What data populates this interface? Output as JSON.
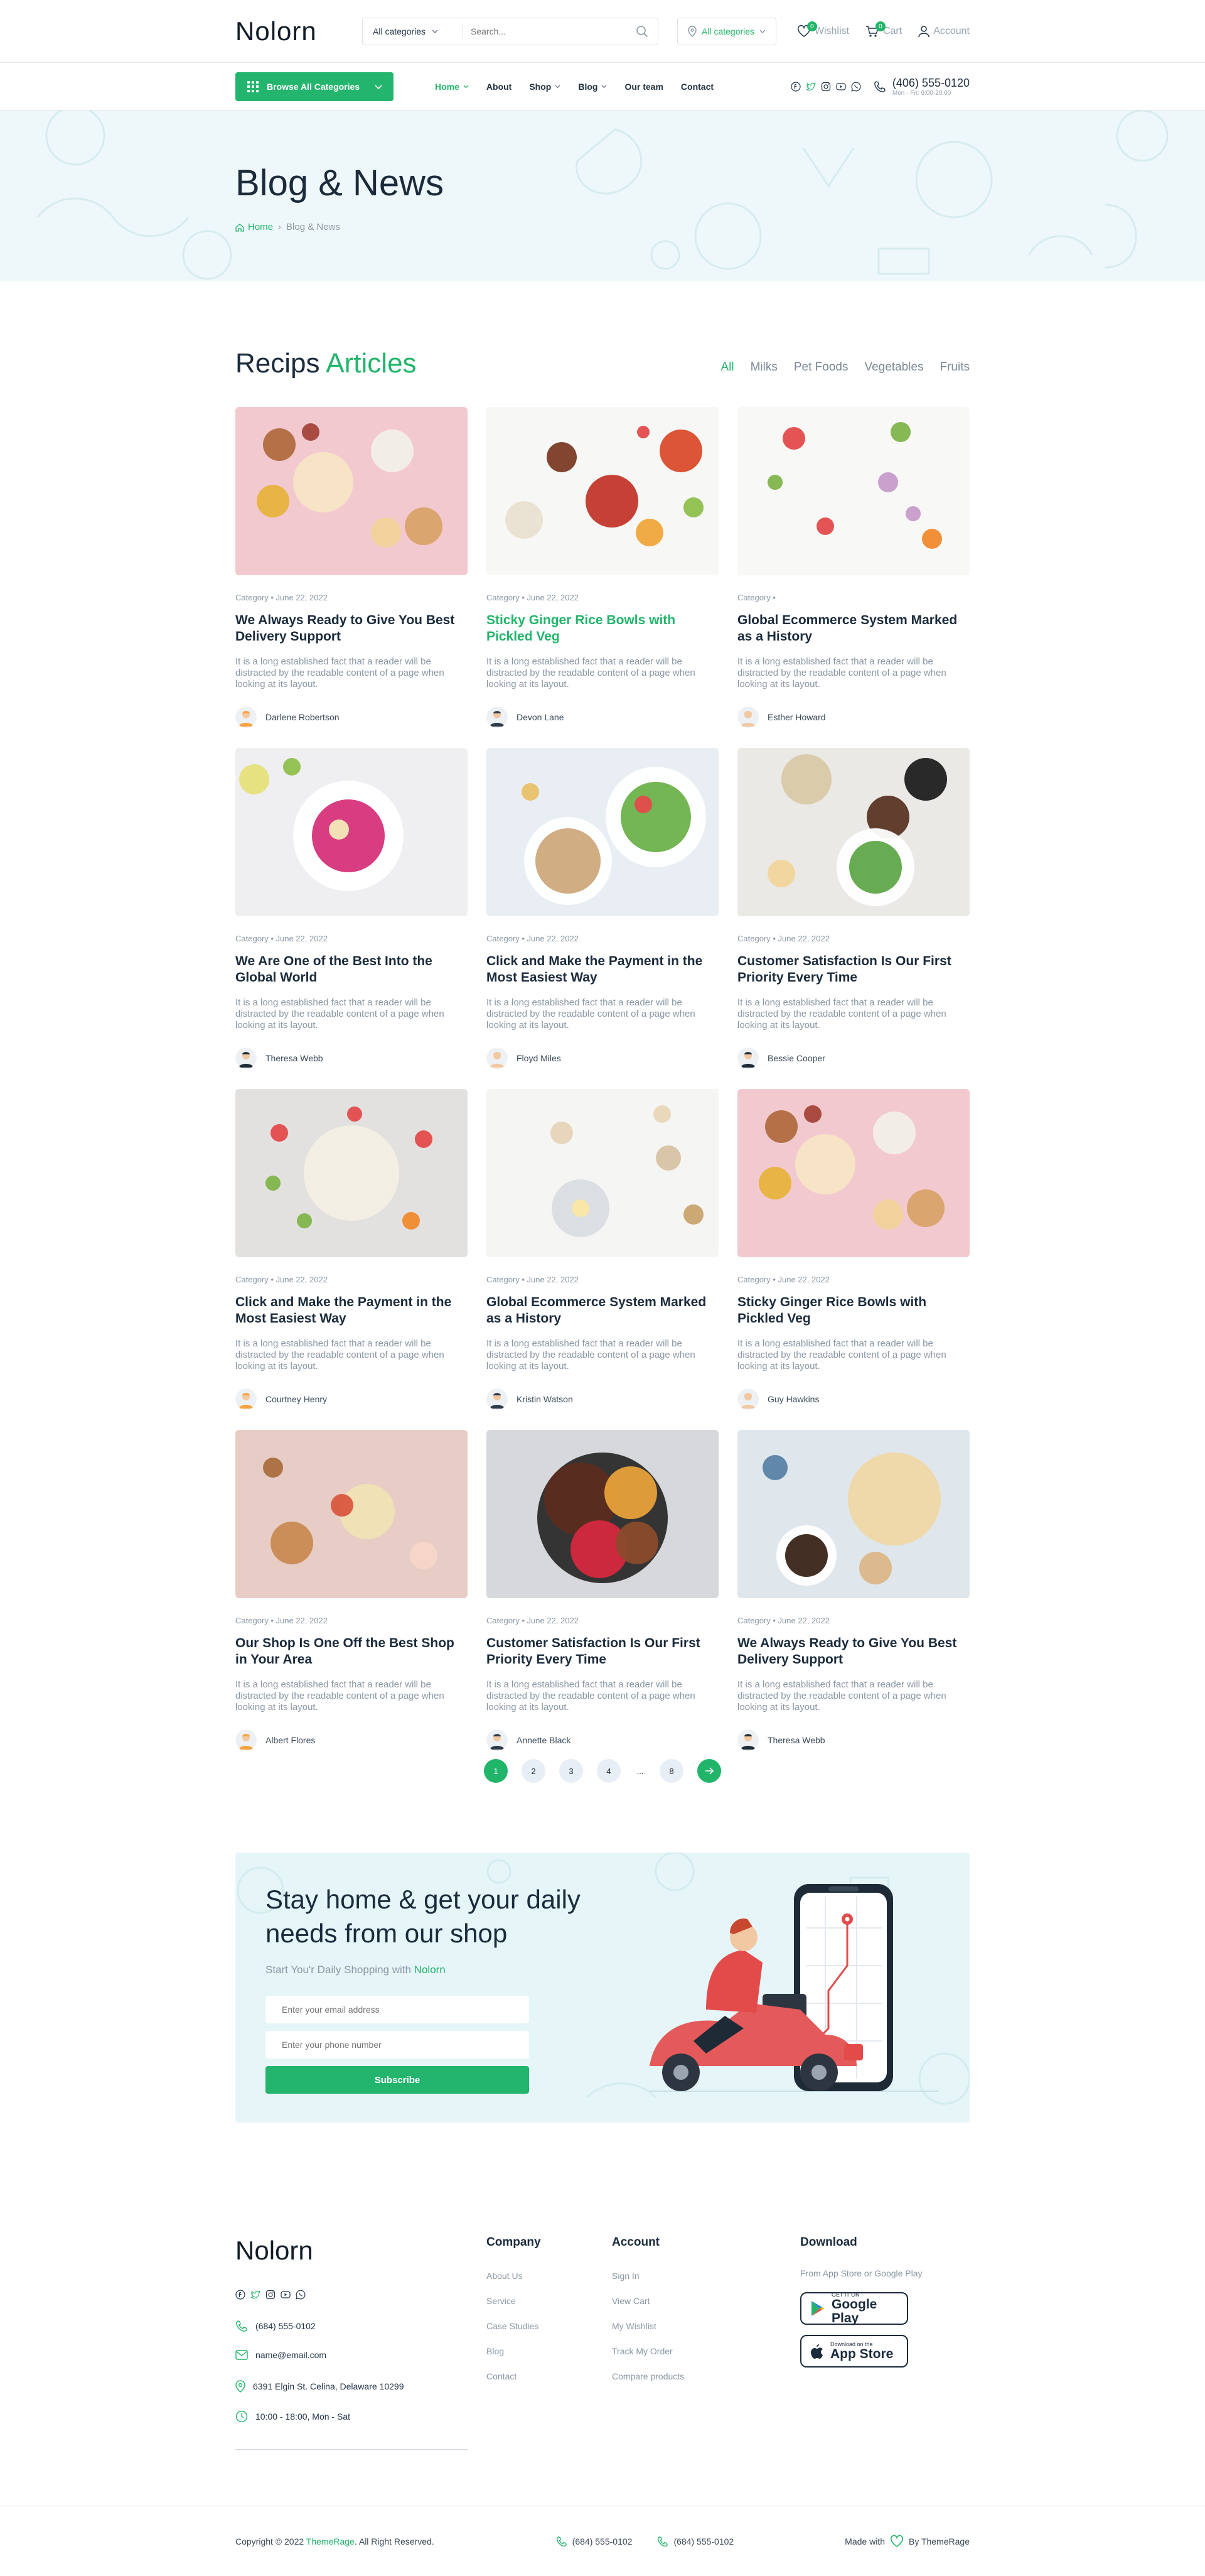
{
  "brand": "Nolorn",
  "search": {
    "category": "All categories",
    "placeholder": "Search..."
  },
  "location": "All categories",
  "topright": {
    "wishlist": "Wishlist",
    "cart": "Cart",
    "account": "Account",
    "wishlist_count": "0",
    "cart_count": "0"
  },
  "nav": {
    "browse": "Browse All Categories",
    "items": [
      {
        "label": "Home",
        "has_dropdown": true,
        "active": true
      },
      {
        "label": "About"
      },
      {
        "label": "Shop",
        "has_dropdown": true
      },
      {
        "label": "Blog",
        "has_dropdown": true
      },
      {
        "label": "Our team"
      },
      {
        "label": "Contact"
      }
    ],
    "phone": "(406) 555-0120",
    "hours": "Mon - Fri: 9:00-20:00"
  },
  "hero": {
    "title": "Blog & News",
    "breadcrumb": [
      "Home",
      "Blog & News"
    ]
  },
  "articles": {
    "title_a": "Recips",
    "title_b": "Articles",
    "filters": [
      "All",
      "Milks",
      "Pet Foods",
      "Vegetables",
      "Fruits"
    ],
    "active_filter": "All",
    "excerpt": "It is a long established fact that a reader will be distracted by the readable content of a page when looking at its layout.",
    "cards": [
      {
        "meta": "Category • June 22, 2022",
        "title": "We Always Ready to Give You Best Delivery Support",
        "author": "Darlene Robertson",
        "highlight": false
      },
      {
        "meta": "Category • June 22, 2022",
        "title": "Sticky Ginger Rice Bowls with Pickled Veg",
        "author": "Devon Lane",
        "highlight": true
      },
      {
        "meta": "Category •",
        "title": "Global Ecommerce System Marked as a History",
        "author": "Esther Howard",
        "highlight": false
      },
      {
        "meta": "Category • June 22, 2022",
        "title": "We Are One of the Best Into the Global World",
        "author": "Theresa Webb",
        "highlight": false
      },
      {
        "meta": "Category • June 22, 2022",
        "title": "Click and Make the Payment in the Most Easiest Way",
        "author": "Floyd Miles",
        "highlight": false
      },
      {
        "meta": "Category • June 22, 2022",
        "title": "Customer Satisfaction Is Our First Priority Every Time",
        "author": "Bessie Cooper",
        "highlight": false
      },
      {
        "meta": "Category • June 22, 2022",
        "title": "Click and Make the Payment in the Most Easiest Way",
        "author": "Courtney Henry",
        "highlight": false
      },
      {
        "meta": "Category • June 22, 2022",
        "title": "Global Ecommerce System Marked as a History",
        "author": "Kristin Watson",
        "highlight": false
      },
      {
        "meta": "Category • June 22, 2022",
        "title": "Sticky Ginger Rice Bowls with Pickled Veg",
        "author": "Guy Hawkins",
        "highlight": false
      },
      {
        "meta": "Category • June 22, 2022",
        "title": "Our Shop Is One Off the Best Shop in Your Area",
        "author": "Albert Flores",
        "highlight": false
      },
      {
        "meta": "Category • June 22, 2022",
        "title": "Customer Satisfaction Is Our First Priority Every Time",
        "author": "Annette Black",
        "highlight": false
      },
      {
        "meta": "Category • June 22, 2022",
        "title": "We Always Ready to Give You Best Delivery Support",
        "author": "Theresa Webb",
        "highlight": false
      }
    ]
  },
  "pagination": {
    "pages": [
      "1",
      "2",
      "3",
      "4",
      "...",
      "8"
    ],
    "current": "1"
  },
  "newsletter": {
    "title": "Stay home & get your daily needs from our shop",
    "subtitle_a": "Start You'r Daily Shopping with",
    "subtitle_b": "Nolorn",
    "email_placeholder": "Enter your email address",
    "phone_placeholder": "Enter your phone number",
    "button": "Subscribe"
  },
  "footer": {
    "brand": "Nolorn",
    "phone": "(684) 555-0102",
    "email": "name@email.com",
    "address": "6391 Elgin St. Celina, Delaware 10299",
    "hours": "10:00 - 18:00, Mon - Sat",
    "company": {
      "title": "Company",
      "links": [
        "About Us",
        "Service",
        "Case Studies",
        "Blog",
        "Contact"
      ]
    },
    "account": {
      "title": "Account",
      "links": [
        "Sign In",
        "View Cart",
        "My Wishlist",
        "Track My Order",
        "Compare products"
      ]
    },
    "download": {
      "title": "Download",
      "subtitle": "From App Store or Google Play",
      "gp_small": "GET IT ON",
      "gp_big": "Google Play",
      "as_small": "Download on the",
      "as_big": "App Store"
    },
    "copyright_a": "Copyright © 2022",
    "copyright_b": "ThemeRage",
    "copyright_c": ". All Right Reserved.",
    "phone1": "(684) 555-0102",
    "phone2": "(684) 555-0102",
    "made_a": "Made with",
    "made_b": "By ThemeRage"
  },
  "colors": {
    "accent": "#21b56a",
    "hero_bg": "#eef8fa",
    "newsletter_bg": "#e6f5f8",
    "text": "#1b2b3c",
    "muted": "#8a96a3"
  }
}
